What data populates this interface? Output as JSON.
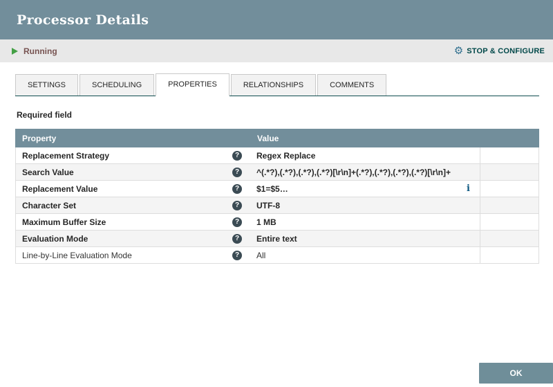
{
  "dialog": {
    "title": "Processor Details"
  },
  "status": {
    "state": "Running",
    "action_label": "STOP & CONFIGURE"
  },
  "tabs": [
    "SETTINGS",
    "SCHEDULING",
    "PROPERTIES",
    "RELATIONSHIPS",
    "COMMENTS"
  ],
  "active_tab": "PROPERTIES",
  "required_field_label": "Required field",
  "table": {
    "columns": [
      "Property",
      "Value"
    ],
    "rows": [
      {
        "property": "Replacement Strategy",
        "value": "Regex Replace"
      },
      {
        "property": "Search Value",
        "value": "^(.*?),(.*?),(.*?),(.*?)[\\r\\n]+(.*?),(.*?),(.*?),(.*?)[\\r\\n]+"
      },
      {
        "property": "Replacement Value",
        "value": "$1=$5…"
      },
      {
        "property": "Character Set",
        "value": "UTF-8"
      },
      {
        "property": "Maximum Buffer Size",
        "value": "1 MB"
      },
      {
        "property": "Evaluation Mode",
        "value": "Entire text"
      },
      {
        "property": "Line-by-Line Evaluation Mode",
        "value": "All"
      }
    ]
  },
  "footer": {
    "ok_label": "OK"
  },
  "colors": {
    "header_bg": "#728e9b",
    "status_bar_bg": "#e8e8e8",
    "running_green": "#44a045",
    "running_text": "#775351",
    "action_teal": "#004849",
    "table_header_bg": "#728e9b",
    "ok_button_bg": "#6f8e99"
  }
}
